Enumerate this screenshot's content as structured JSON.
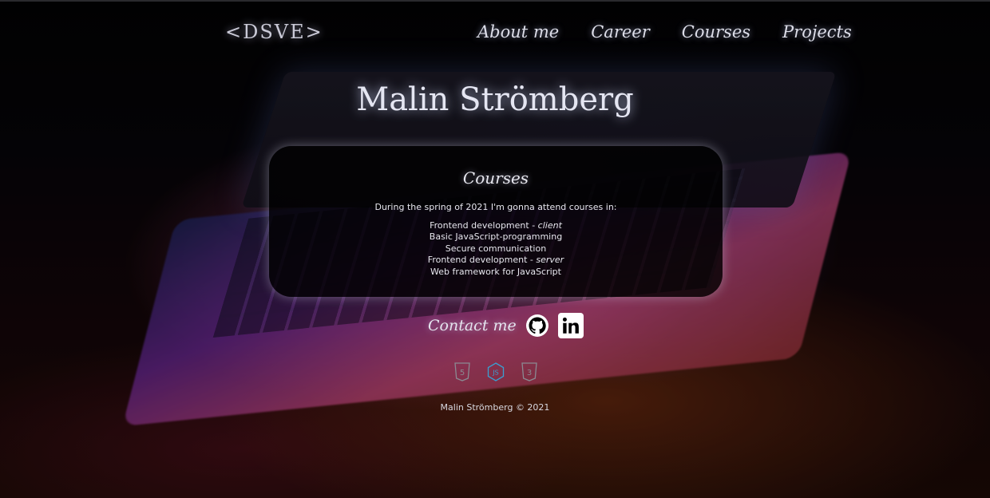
{
  "header": {
    "logo": "<DSVE>",
    "nav": [
      "About me",
      "Career",
      "Courses",
      "Projects"
    ]
  },
  "title": "Malin Strömberg",
  "courses": {
    "heading": "Courses",
    "intro": "During the spring of 2021 I'm gonna attend courses in:",
    "items": [
      {
        "text": "Frontend development - ",
        "em": "client"
      },
      {
        "text": "Basic JavaScript-programming",
        "em": ""
      },
      {
        "text": "Secure communication",
        "em": ""
      },
      {
        "text": "Frontend development - ",
        "em": "server"
      },
      {
        "text": "Web framework for JavaScript",
        "em": ""
      }
    ]
  },
  "contact": {
    "label": "Contact me",
    "icons": [
      "github-icon",
      "linkedin-icon"
    ]
  },
  "tech_icons": [
    "html5-icon",
    "nodejs-icon",
    "css3-icon"
  ],
  "footer": "Malin Strömberg © 2021",
  "colors": {
    "text": "#e5e6f2",
    "card_bg": "#000000",
    "nodejs": "#3a9fd1"
  }
}
